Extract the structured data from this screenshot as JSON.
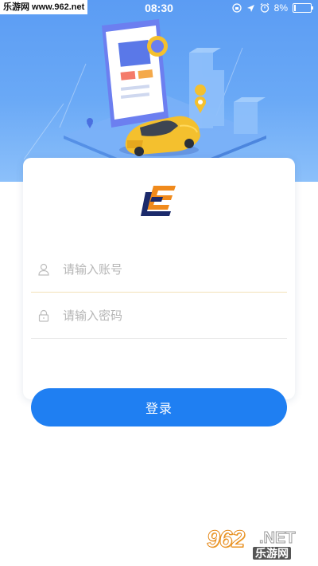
{
  "watermark_top": "乐游网 www.962.net",
  "status_bar": {
    "time": "08:30",
    "battery": "8%",
    "battery_level": 0.08
  },
  "login": {
    "username_placeholder": "请输入账号",
    "password_placeholder": "请输入密码",
    "submit_label": "登录"
  },
  "watermark_bottom": {
    "number": "962",
    "suffix": ".NET",
    "site_name": "乐游网"
  },
  "colors": {
    "hero_blue": "#5b9cf3",
    "button_blue": "#1f7ff2",
    "car_yellow": "#f4c02e",
    "logo_navy": "#1b2a6b",
    "logo_orange": "#f08a1c"
  },
  "icons": [
    "user-icon",
    "lock-icon",
    "location-pin-icon",
    "alarm-icon",
    "battery-icon"
  ]
}
